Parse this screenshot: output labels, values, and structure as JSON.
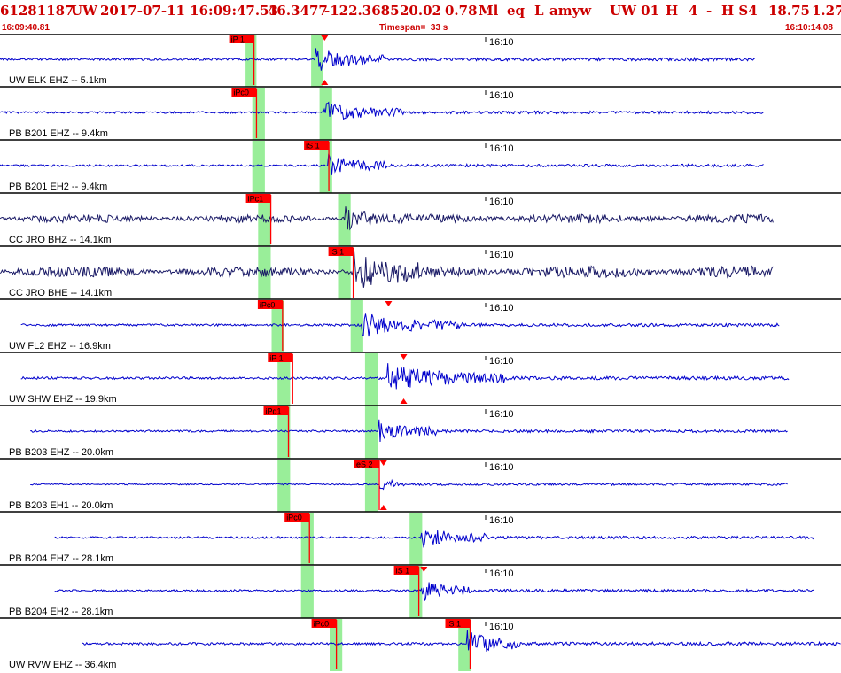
{
  "header": {
    "event_id": "61281187",
    "network": "UW",
    "origin_time": "2017-07-11 16:09:47.53",
    "latitude": "46.3477",
    "longitude": "-122.3685",
    "depth": "20.02",
    "magnitude": "0.78",
    "mag_type": "Ml",
    "event_type": "eq",
    "event_class": "L",
    "author": "amyw",
    "source": "UW 01",
    "flag": "H",
    "nphases": "4",
    "dash": "-",
    "hs": "H S4",
    "gap": "18.75",
    "rms": "1.27"
  },
  "subheader": {
    "start_time": "16:09:40.81",
    "timespan": "Timespan=  33 s",
    "end_time": "16:10:14.08"
  },
  "colors": {
    "header_text": "#cc0000",
    "trace_blue": "#0000cc",
    "trace_navy": "#1a1a66",
    "pick_red": "#ff0000",
    "window_green": "#99ee99",
    "separator": "#000000"
  },
  "minute_mark": "16:10",
  "channels": [
    {
      "label": "UW ELK EHZ -- 5.1km",
      "trace_color": "blue",
      "trace_start": 0.0,
      "trace_end": 0.899,
      "amplitude": 0.5,
      "green_windows": [
        [
          0.292,
          0.305
        ],
        [
          0.37,
          0.384
        ]
      ],
      "picks": [
        {
          "tag": "iP 1",
          "pos": 0.302,
          "above": true
        }
      ],
      "triangles": [
        {
          "pos": 0.386,
          "top": true
        },
        {
          "pos": 0.386,
          "top": false
        }
      ],
      "burst": [
        0.375,
        0.46
      ]
    },
    {
      "label": "PB B201 EHZ -- 9.4km",
      "trace_color": "blue",
      "trace_start": 0.0,
      "trace_end": 0.908,
      "amplitude": 0.45,
      "green_windows": [
        [
          0.3,
          0.315
        ],
        [
          0.38,
          0.395
        ]
      ],
      "picks": [
        {
          "tag": "iPc0",
          "pos": 0.305,
          "above": true
        }
      ],
      "triangles": [],
      "burst": [
        0.385,
        0.48
      ]
    },
    {
      "label": "PB B201 EH2 -- 9.4km",
      "trace_color": "blue",
      "trace_start": 0.0,
      "trace_end": 0.908,
      "amplitude": 0.45,
      "green_windows": [
        [
          0.3,
          0.315
        ],
        [
          0.38,
          0.395
        ]
      ],
      "picks": [
        {
          "tag": "iS 1",
          "pos": 0.391,
          "above": true
        }
      ],
      "triangles": [],
      "burst": [
        0.39,
        0.46
      ]
    },
    {
      "label": "CC JRO BHZ -- 14.1km",
      "trace_color": "navy",
      "trace_start": 0.0,
      "trace_end": 0.92,
      "amplitude": 0.55,
      "green_windows": [
        [
          0.307,
          0.322
        ],
        [
          0.402,
          0.417
        ]
      ],
      "picks": [
        {
          "tag": "iPc1",
          "pos": 0.322,
          "above": true
        }
      ],
      "triangles": [],
      "burst": [
        0.41,
        0.45
      ]
    },
    {
      "label": "CC JRO BHE -- 14.1km",
      "trace_color": "navy",
      "trace_start": 0.0,
      "trace_end": 0.92,
      "amplitude": 0.7,
      "green_windows": [
        [
          0.307,
          0.322
        ],
        [
          0.402,
          0.417
        ]
      ],
      "picks": [
        {
          "tag": "iS 1",
          "pos": 0.42,
          "above": true
        }
      ],
      "triangles": [],
      "burst": [
        0.42,
        0.5
      ]
    },
    {
      "label": "UW FL2 EHZ -- 16.9km",
      "trace_color": "blue",
      "trace_start": 0.025,
      "trace_end": 0.927,
      "amplitude": 0.5,
      "green_windows": [
        [
          0.323,
          0.338
        ],
        [
          0.417,
          0.432
        ]
      ],
      "picks": [
        {
          "tag": "iPc0",
          "pos": 0.336,
          "above": true
        }
      ],
      "triangles": [
        {
          "pos": 0.462,
          "top": true
        }
      ],
      "burst": [
        0.43,
        0.55
      ]
    },
    {
      "label": "UW SHW EHZ -- 19.9km",
      "trace_color": "blue",
      "trace_start": 0.025,
      "trace_end": 0.939,
      "amplitude": 0.55,
      "green_windows": [
        [
          0.33,
          0.345
        ],
        [
          0.434,
          0.449
        ]
      ],
      "picks": [
        {
          "tag": "iP 1",
          "pos": 0.348,
          "above": true
        }
      ],
      "triangles": [
        {
          "pos": 0.48,
          "top": true
        },
        {
          "pos": 0.48,
          "top": false
        }
      ],
      "burst": [
        0.46,
        0.6
      ]
    },
    {
      "label": "PB B203 EHZ -- 20.0km",
      "trace_color": "blue",
      "trace_start": 0.036,
      "trace_end": 0.937,
      "amplitude": 0.45,
      "green_windows": [
        [
          0.33,
          0.345
        ],
        [
          0.434,
          0.449
        ]
      ],
      "picks": [
        {
          "tag": "iPd1",
          "pos": 0.343,
          "above": true
        }
      ],
      "triangles": [],
      "burst": [
        0.45,
        0.52
      ]
    },
    {
      "label": "PB B203 EH1 -- 20.0km",
      "trace_color": "blue",
      "trace_start": 0.036,
      "trace_end": 0.937,
      "amplitude": 0.35,
      "green_windows": [
        [
          0.33,
          0.345
        ],
        [
          0.434,
          0.449
        ]
      ],
      "picks": [
        {
          "tag": "eS 2",
          "pos": 0.451,
          "above": true
        }
      ],
      "triangles": [
        {
          "pos": 0.456,
          "top": true
        },
        {
          "pos": 0.456,
          "top": false
        }
      ],
      "burst": [
        0.452,
        0.48
      ]
    },
    {
      "label": "PB B204 EHZ -- 28.1km",
      "trace_color": "blue",
      "trace_start": 0.065,
      "trace_end": 0.968,
      "amplitude": 0.45,
      "green_windows": [
        [
          0.358,
          0.373
        ],
        [
          0.487,
          0.502
        ]
      ],
      "picks": [
        {
          "tag": "iPc0",
          "pos": 0.368,
          "above": true
        }
      ],
      "triangles": [],
      "burst": [
        0.5,
        0.58
      ]
    },
    {
      "label": "PB B204 EH2 -- 28.1km",
      "trace_color": "blue",
      "trace_start": 0.065,
      "trace_end": 0.968,
      "amplitude": 0.45,
      "green_windows": [
        [
          0.358,
          0.373
        ],
        [
          0.487,
          0.502
        ]
      ],
      "picks": [
        {
          "tag": "iS 1",
          "pos": 0.498,
          "above": true
        }
      ],
      "triangles": [
        {
          "pos": 0.504,
          "top": true
        }
      ],
      "burst": [
        0.5,
        0.56
      ]
    },
    {
      "label": "UW RVW EHZ -- 36.4km",
      "trace_color": "blue",
      "trace_start": 0.098,
      "trace_end": 1.0,
      "amplitude": 0.55,
      "green_windows": [
        [
          0.392,
          0.407
        ],
        [
          0.545,
          0.56
        ]
      ],
      "picks": [
        {
          "tag": "iPc0",
          "pos": 0.4,
          "above": true
        },
        {
          "tag": "iS 1",
          "pos": 0.559,
          "above": true
        }
      ],
      "triangles": [],
      "burst": [
        0.555,
        0.62
      ]
    }
  ]
}
